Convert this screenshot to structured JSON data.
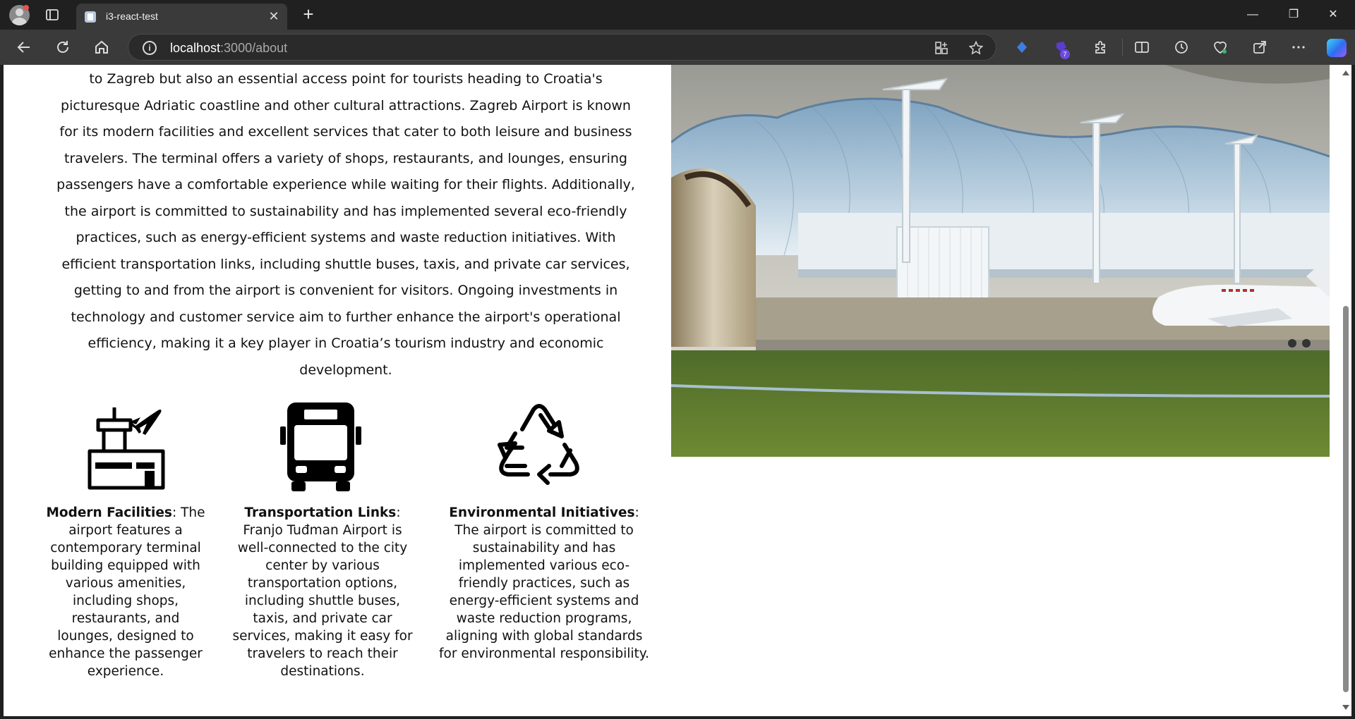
{
  "browser": {
    "tab_title": "i3-react-test",
    "tab_close": "✕",
    "new_tab": "+",
    "url_host": "localhost",
    "url_rest": ":3000/about",
    "info_icon": "i",
    "extension_badge": "7",
    "window": {
      "minimize": "—",
      "restore": "❐",
      "close": "✕"
    }
  },
  "page": {
    "intro_text": "to Zagreb but also an essential access point for tourists heading to Croatia's picturesque Adriatic coastline and other cultural attractions. Zagreb Airport is known for its modern facilities and excellent services that cater to both leisure and business travelers. The terminal offers a variety of shops, restaurants, and lounges, ensuring passengers have a comfortable experience while waiting for their flights. Additionally, the airport is committed to sustainability and has implemented several eco-friendly practices, such as energy-efficient systems and waste reduction initiatives. With efficient transportation links, including shuttle buses, taxis, and private car services, getting to and from the airport is convenient for visitors. Ongoing investments in technology and customer service aim to further enhance the airport's operational efficiency, making it a key player in Croatia’s tourism industry and economic development.",
    "features": [
      {
        "icon": "airport-tower-icon",
        "title": "Modern Facilities",
        "text": ": The airport features a contemporary terminal building equipped with various amenities, including shops, restaurants, and lounges, designed to enhance the passenger experience."
      },
      {
        "icon": "bus-icon",
        "title": "Transportation Links",
        "text": ": Franjo Tuđman Airport is well-connected to the city center by various transportation options, including shuttle buses, taxis, and private car services, making it easy for travelers to reach their destinations."
      },
      {
        "icon": "recycle-icon",
        "title": "Environmental Initiatives",
        "text": ": The airport is committed to sustainability and has implemented various eco-friendly practices, such as energy-efficient systems and waste reduction programs, aligning with global standards for environmental responsibility."
      }
    ]
  }
}
